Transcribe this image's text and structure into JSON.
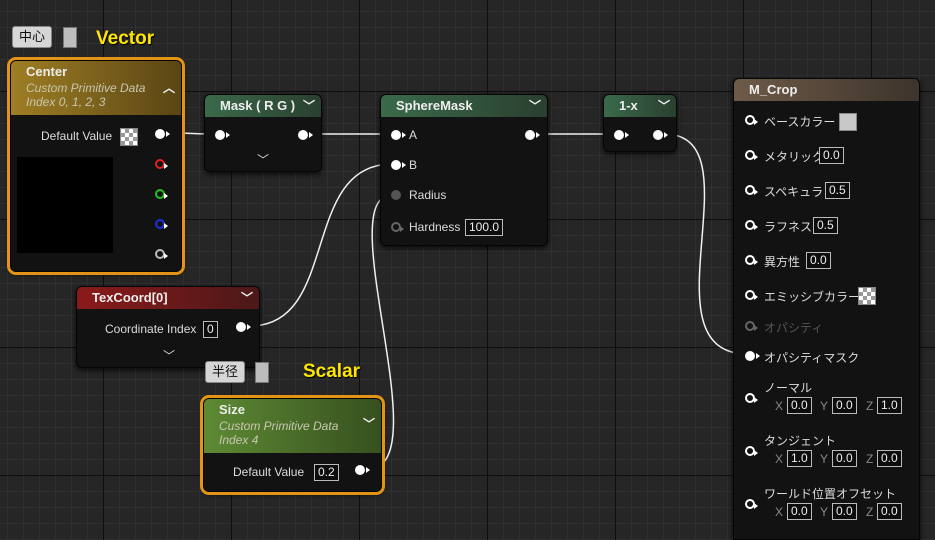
{
  "comments": {
    "vector_label": "Vector",
    "scalar_label": "Scalar"
  },
  "bubbles": {
    "center_bubble": "中心",
    "size_bubble": "半径"
  },
  "nodes": {
    "center": {
      "title": "Center",
      "subtitle_line1": "Custom Primitive Data",
      "subtitle_line2": "Index 0, 1, 2, 3",
      "default_value_label": "Default Value",
      "outputs": [
        "white",
        "red",
        "green",
        "blue",
        "alpha"
      ]
    },
    "mask": {
      "title": "Mask ( R G )"
    },
    "spheremask": {
      "title": "SphereMask",
      "inputs": {
        "a": "A",
        "b": "B",
        "radius": "Radius",
        "hardness": "Hardness"
      },
      "hardness_value": "100.0"
    },
    "oneminus": {
      "title": "1-x"
    },
    "texcoord": {
      "title": "TexCoord[0]",
      "coordinate_index_label": "Coordinate Index",
      "coordinate_index_value": "0"
    },
    "size": {
      "title": "Size",
      "subtitle_line1": "Custom Primitive Data",
      "subtitle_line2": "Index 4",
      "default_value_label": "Default Value",
      "default_value": "0.2"
    },
    "material": {
      "title": "M_Crop",
      "inputs": {
        "base_color": "ベースカラー",
        "metallic": "メタリック",
        "metallic_value": "0.0",
        "specular": "スペキュラ",
        "specular_value": "0.5",
        "roughness": "ラフネス",
        "roughness_value": "0.5",
        "anisotropy": "異方性",
        "anisotropy_value": "0.0",
        "emissive": "エミッシブカラー",
        "opacity": "オパシティ",
        "opacity_mask": "オパシティマスク",
        "normal": "ノーマル",
        "normal_x": "0.0",
        "normal_y": "0.0",
        "normal_z": "1.0",
        "tangent": "タンジェント",
        "tangent_x": "1.0",
        "tangent_y": "0.0",
        "tangent_z": "0.0",
        "wpo": "ワールド位置オフセット",
        "wpo_x": "0.0",
        "wpo_y": "0.0",
        "wpo_z": "0.0"
      },
      "axes": {
        "x": "X",
        "y": "Y",
        "z": "Z"
      }
    }
  },
  "colors": {
    "background": "#262626",
    "selection_outline": "#e39316",
    "comment_text": "#ffe600",
    "wire": "#ffffff"
  }
}
